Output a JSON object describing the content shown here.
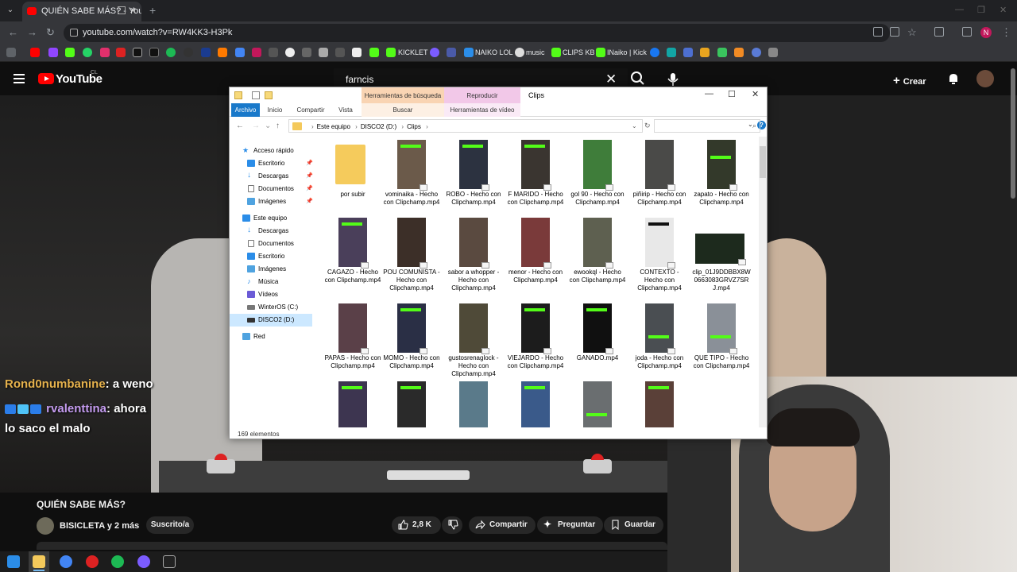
{
  "browser": {
    "tab_title": "QUIÉN SABE MÁS? - YouTube",
    "url": "youtube.com/watch?v=RW4KK3-H3Pk",
    "profile_initial": "N",
    "bookmarks": [
      "KICKLET",
      "NAIKO LOL",
      "music",
      "CLIPS KB",
      "INaiko | Kick"
    ]
  },
  "youtube": {
    "logo": "YouTube",
    "country": "CL",
    "search_value": "farncis",
    "create_label": "Crear"
  },
  "chat": [
    {
      "user": "Rond0numbanine",
      "text": ": a weno"
    },
    {
      "user": "rvalenttina",
      "text": ": ahora"
    },
    {
      "user": "",
      "text": "lo saco el malo"
    }
  ],
  "video": {
    "title": "QUIÉN SABE MÁS?",
    "channel": "BISICLETA y 2 más",
    "subscribed": "Suscrito/a",
    "likes": "2,8 K",
    "share": "Compartir",
    "ask": "Preguntar",
    "save": "Guardar"
  },
  "explorer": {
    "window_title": "Clips",
    "ctx_search_tools": "Herramientas de búsqueda",
    "ctx_play": "Reproducir",
    "tabs": {
      "file": "Archivo",
      "home": "Inicio",
      "share": "Compartir",
      "view": "Vista",
      "search": "Buscar",
      "video_tools": "Herramientas de vídeo"
    },
    "breadcrumb": [
      "Este equipo",
      "DISCO2 (D:)",
      "Clips"
    ],
    "nav": {
      "quick_access": "Acceso rápido",
      "qa_desktop": "Escritorio",
      "qa_downloads": "Descargas",
      "qa_documents": "Documentos",
      "qa_images": "Imágenes",
      "this_pc": "Este equipo",
      "pc_downloads": "Descargas",
      "pc_documents": "Documentos",
      "pc_desktop": "Escritorio",
      "pc_images": "Imágenes",
      "pc_music": "Música",
      "pc_videos": "Vídeos",
      "pc_c": "WinterOS (C:)",
      "pc_d": "DISCO2 (D:)",
      "network": "Red"
    },
    "files": [
      "por subir",
      "vominaika - Hecho con Clipchamp.mp4",
      "ROBO - Hecho con Clipchamp.mp4",
      "F MARIDO - Hecho con Clipchamp.mp4",
      "gol 90 - Hecho con Clipchamp.mp4",
      "piñirip - Hecho con Clipchamp.mp4",
      "zapato - Hecho con Clipchamp.mp4",
      "CAGAZO - Hecho con Clipchamp.mp4",
      "POU COMUNISTA - Hecho con Clipchamp.mp4",
      "sabor a whopper - Hecho con Clipchamp.mp4",
      "menor - Hecho con Clipchamp.mp4",
      "ewookql - Hecho con Clipchamp.mp4",
      "CONTEXTO - Hecho con Clipchamp.mp4",
      "clip_01J9DDBBX8W0663083GRVZ7SRJ.mp4",
      "PAPAS - Hecho con Clipchamp.mp4",
      "MOMO - Hecho con Clipchamp.mp4",
      "gustosrenaglock - Hecho con Clipchamp.mp4",
      "VIEJARDO - Hecho con Clipchamp.mp4",
      "GANADO.mp4",
      "joda - Hecho con Clipchamp.mp4",
      "QUE TIPO - Hecho con Clipchamp.mp4"
    ],
    "status": "169 elementos"
  },
  "colors": {
    "accent_blue": "#1979ca",
    "youtube_red": "#ff0000",
    "kick_green": "#53fc18"
  }
}
